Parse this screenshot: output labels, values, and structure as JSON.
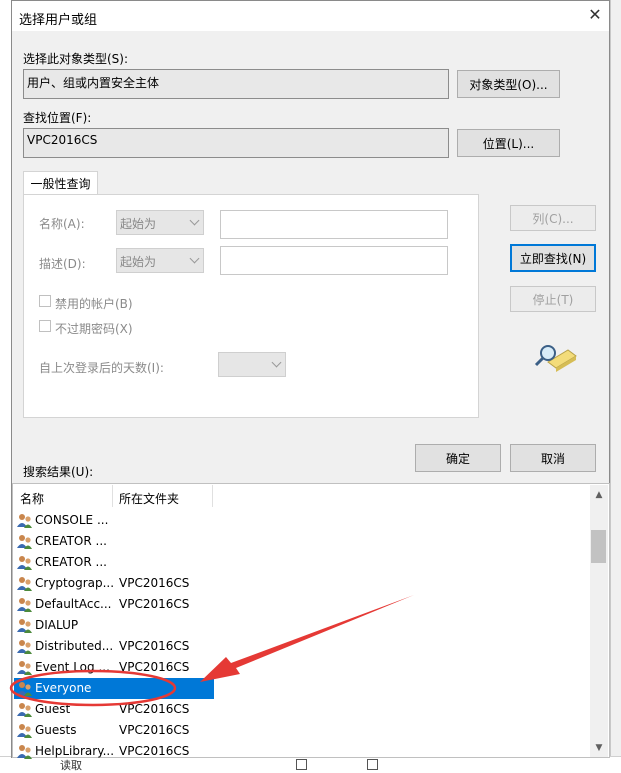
{
  "dialog": {
    "title": "选择用户或组",
    "close_glyph": "✕"
  },
  "object_type": {
    "label": "选择此对象类型(S):",
    "value": "用户、组或内置安全主体",
    "button": "对象类型(O)..."
  },
  "location": {
    "label": "查找位置(F):",
    "value": "VPC2016CS",
    "button": "位置(L)..."
  },
  "query": {
    "tab": "一般性查询",
    "name_label": "名称(A):",
    "name_combo": "起始为",
    "desc_label": "描述(D):",
    "desc_combo": "起始为",
    "disabled_accounts": "禁用的帐户(B)",
    "no_expire_pw": "不过期密码(X)",
    "days_since_login": "自上次登录后的天数(I):"
  },
  "side_buttons": {
    "columns": "列(C)...",
    "find_now": "立即查找(N)",
    "stop": "停止(T)"
  },
  "ok_button": "确定",
  "cancel_button": "取消",
  "results": {
    "label": "搜索结果(U):",
    "headers": {
      "name": "名称",
      "folder": "所在文件夹"
    },
    "rows": [
      {
        "name": "CONSOLE ...",
        "folder": ""
      },
      {
        "name": "CREATOR ...",
        "folder": ""
      },
      {
        "name": "CREATOR ...",
        "folder": ""
      },
      {
        "name": "Cryptograp...",
        "folder": "VPC2016CS"
      },
      {
        "name": "DefaultAcc...",
        "folder": "VPC2016CS"
      },
      {
        "name": "DIALUP",
        "folder": ""
      },
      {
        "name": "Distributed...",
        "folder": "VPC2016CS"
      },
      {
        "name": "Event Log ...",
        "folder": "VPC2016CS"
      },
      {
        "name": "Everyone",
        "folder": ""
      },
      {
        "name": "Guest",
        "folder": "VPC2016CS"
      },
      {
        "name": "Guests",
        "folder": "VPC2016CS"
      },
      {
        "name": "HelpLibrary...",
        "folder": "VPC2016CS"
      }
    ]
  },
  "background": {
    "bottom_text": "读取"
  },
  "colors": {
    "selection": "#0078d7",
    "annotation": "#e53935"
  }
}
